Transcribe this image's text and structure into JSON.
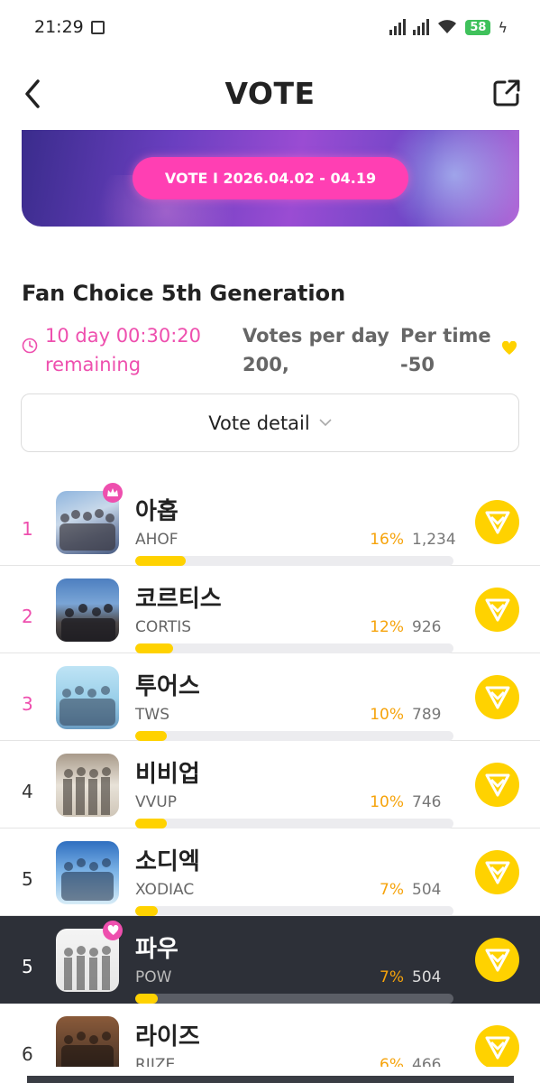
{
  "status_bar": {
    "time": "21:29",
    "battery": "58"
  },
  "header": {
    "title": "VOTE"
  },
  "banner": {
    "period": "VOTE I 2026.04.02 - 04.19"
  },
  "vote": {
    "title": "Fan Choice 5th Generation",
    "remaining_line1": "10 day 00:30:20",
    "remaining_line2": "remaining",
    "per_day_label": "Votes per day",
    "per_day_value": "200,",
    "per_time_label": "Per time",
    "per_time_value": "-50",
    "detail_button": "Vote detail"
  },
  "colors": {
    "accent_pink": "#ee4fae",
    "vote_yellow": "#ffd200",
    "percent_orange": "#f6a30b",
    "highlight_row": "#2d3038"
  },
  "rankings": [
    {
      "rank": "1",
      "name": "아홉",
      "eng": "AHOF",
      "percent": "16%",
      "votes": "1,234",
      "share": 0.16,
      "badge": "crown-icon"
    },
    {
      "rank": "2",
      "name": "코르티스",
      "eng": "CORTIS",
      "percent": "12%",
      "votes": "926",
      "share": 0.12
    },
    {
      "rank": "3",
      "name": "투어스",
      "eng": "TWS",
      "percent": "10%",
      "votes": "789",
      "share": 0.1
    },
    {
      "rank": "4",
      "name": "비비업",
      "eng": "VVUP",
      "percent": "10%",
      "votes": "746",
      "share": 0.1
    },
    {
      "rank": "5",
      "name": "소디엑",
      "eng": "XODIAC",
      "percent": "7%",
      "votes": "504",
      "share": 0.07
    },
    {
      "rank": "5",
      "name": "파우",
      "eng": "POW",
      "percent": "7%",
      "votes": "504",
      "share": 0.07,
      "badge": "heart-icon"
    },
    {
      "rank": "6",
      "name": "라이즈",
      "eng": "RIIZE",
      "percent": "6%",
      "votes": "466",
      "share": 0.06
    }
  ]
}
